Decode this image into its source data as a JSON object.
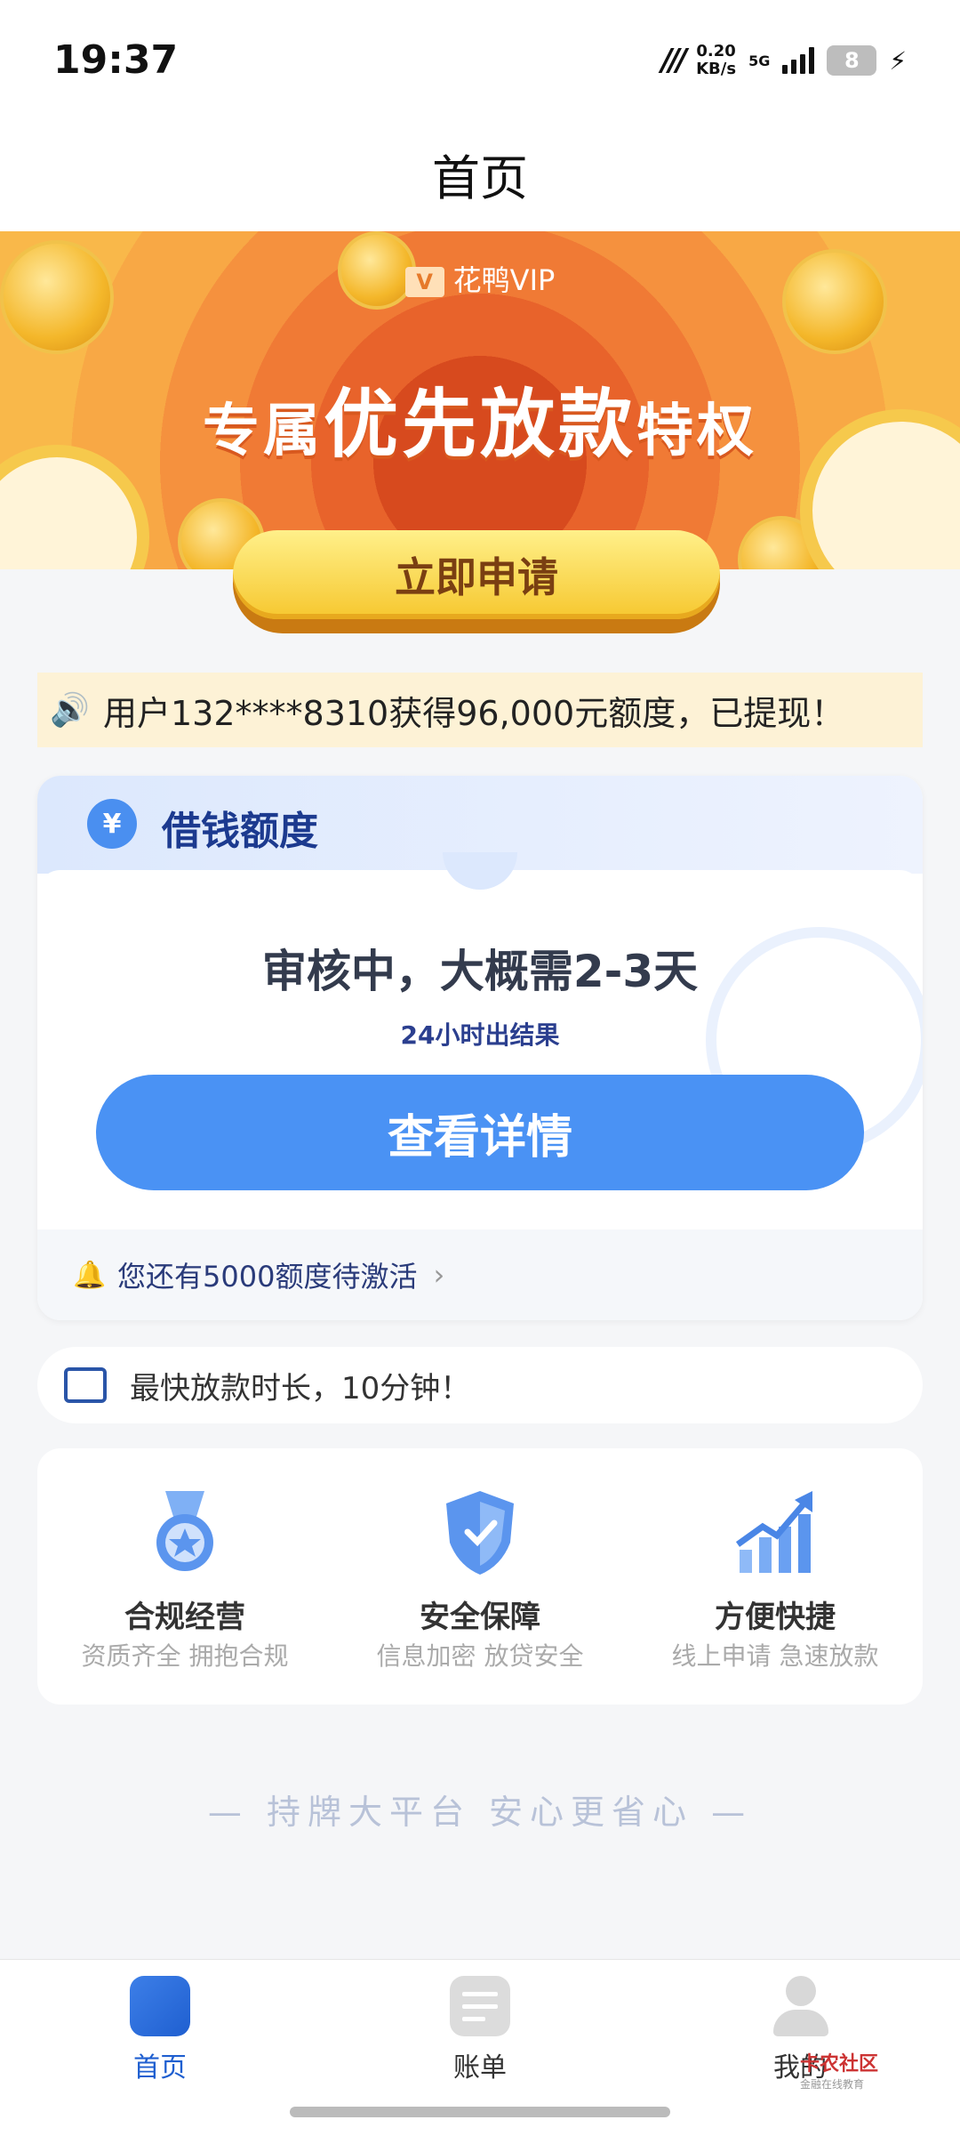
{
  "status_bar": {
    "time": "19:37",
    "speed_value": "0.20",
    "speed_unit": "KB/s",
    "network": "5G",
    "battery": "8"
  },
  "header": {
    "title": "首页"
  },
  "banner": {
    "vip_label": "花鸭VIP",
    "slogan_part1": "专属",
    "slogan_part2": "优先放款",
    "slogan_part3": "特权",
    "apply_button": "立即申请"
  },
  "notice": {
    "text": "用户132****8310获得96,000元额度，已提现！"
  },
  "credit_card": {
    "title": "借钱额度",
    "status": "审核中，大概需2-3天",
    "sub_status": "24小时出结果",
    "detail_button": "查看详情",
    "footer_text": "您还有5000额度待激活"
  },
  "fast_loan": {
    "text": "最快放款时长，10分钟！"
  },
  "features": [
    {
      "title": "合规经营",
      "subtitle": "资质齐全 拥抱合规"
    },
    {
      "title": "安全保障",
      "subtitle": "信息加密 放贷安全"
    },
    {
      "title": "方便快捷",
      "subtitle": "线上申请 急速放款"
    }
  ],
  "tagline": "— 持牌大平台 安心更省心 —",
  "bottom_nav": [
    {
      "label": "首页",
      "active": true
    },
    {
      "label": "账单",
      "active": false
    },
    {
      "label": "我的",
      "active": false
    }
  ],
  "watermark": {
    "title": "卡农社区",
    "subtitle": "金融在线教育"
  },
  "colors": {
    "primary_blue": "#4a92f4",
    "nav_active": "#1f5fd0",
    "banner_orange": "#f07a35",
    "apply_yellow": "#f6c72e"
  }
}
